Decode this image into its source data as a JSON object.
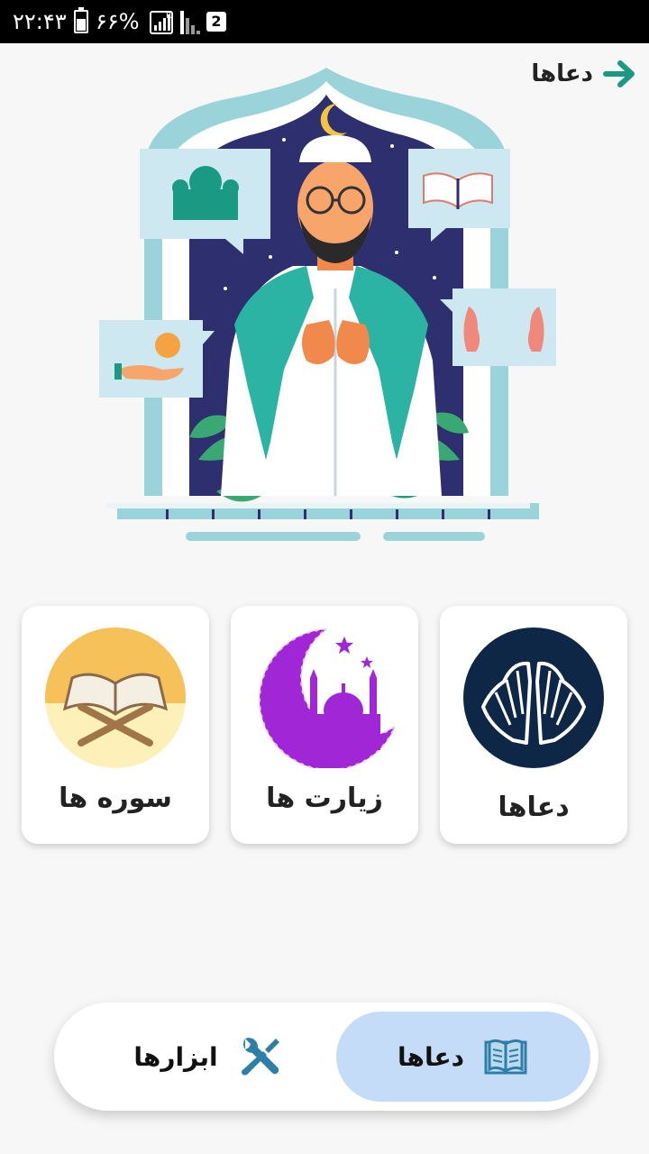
{
  "status_bar": {
    "time": "۲۲:۴۳",
    "battery": "۶۶%",
    "sim_slot": "2",
    "signal_badge": "R"
  },
  "header": {
    "title": "دعاها",
    "back_icon": "arrow-right-icon"
  },
  "hero": {
    "illustration": "praying-man-illustration"
  },
  "categories": [
    {
      "label": "دعاها",
      "icon": "praying-hands-icon"
    },
    {
      "label": "زیارت ها",
      "icon": "mosque-crescent-icon"
    },
    {
      "label": "سوره ها",
      "icon": "quran-stand-icon"
    }
  ],
  "bottom_nav": {
    "items": [
      {
        "label": "دعاها",
        "icon": "book-icon",
        "active": true
      },
      {
        "label": "ابزارها",
        "icon": "tools-icon",
        "active": false
      }
    ]
  },
  "colors": {
    "accent_green": "#1a9a82",
    "nav_active_bg": "#c4dcf7",
    "navy": "#0f2747",
    "purple": "#a126d6"
  }
}
